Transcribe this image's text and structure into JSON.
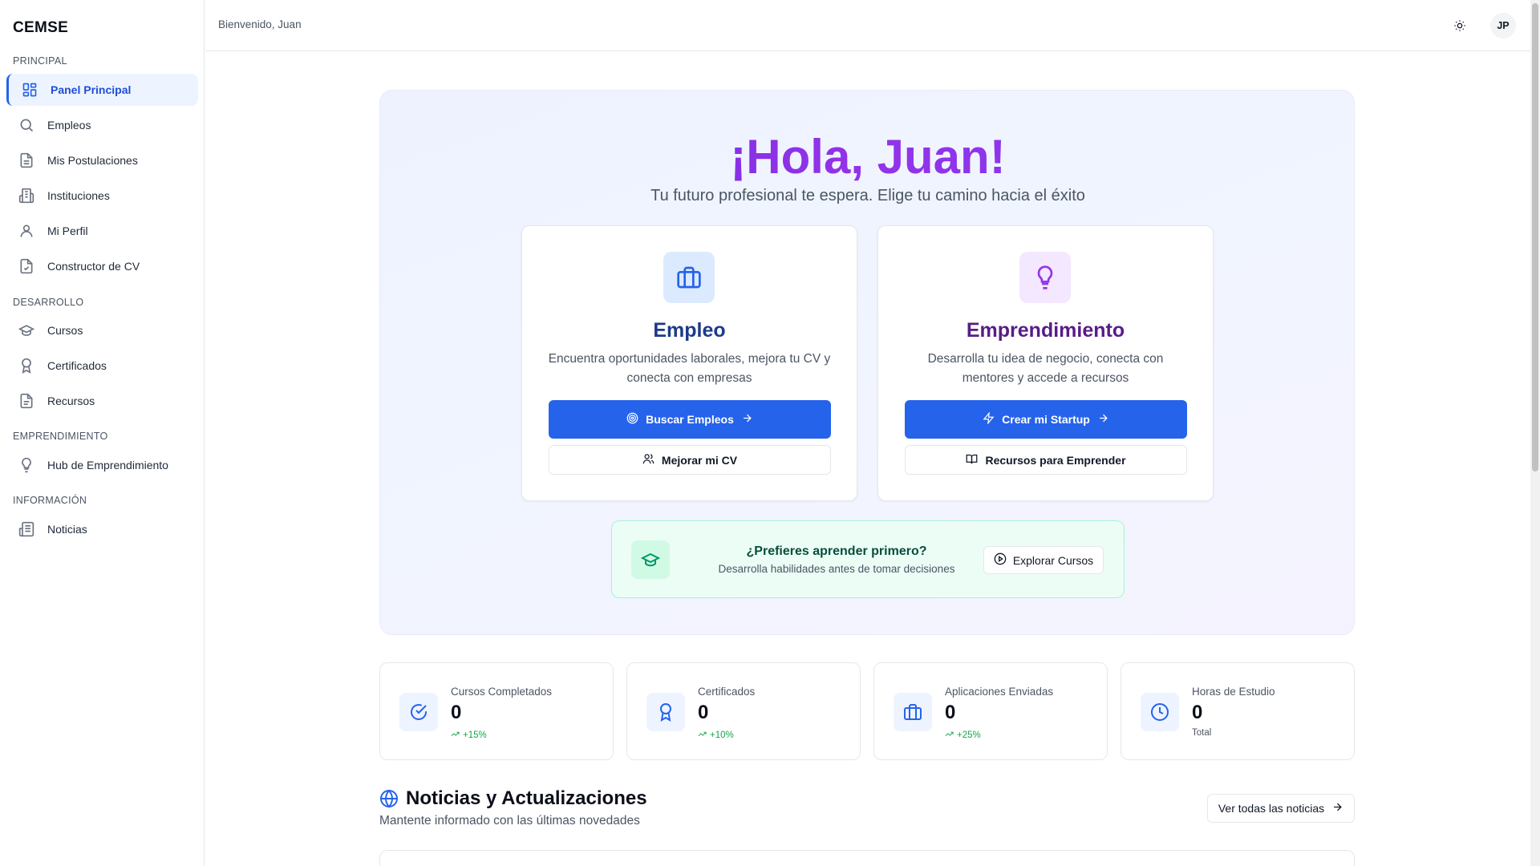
{
  "brand": "CEMSE",
  "sidebar": {
    "sections": [
      "PRINCIPAL",
      "DESARROLLO",
      "EMPRENDIMIENTO",
      "INFORMACIÓN"
    ],
    "items": [
      {
        "label": "Panel Principal",
        "icon": "dashboard-icon",
        "active": true
      },
      {
        "label": "Empleos",
        "icon": "search-icon"
      },
      {
        "label": "Mis Postulaciones",
        "icon": "document-icon"
      },
      {
        "label": "Instituciones",
        "icon": "building-icon"
      },
      {
        "label": "Mi Perfil",
        "icon": "user-icon"
      },
      {
        "label": "Constructor de CV",
        "icon": "file-check-icon"
      },
      {
        "label": "Cursos",
        "icon": "graduation-cap-icon"
      },
      {
        "label": "Certificados",
        "icon": "award-icon"
      },
      {
        "label": "Recursos",
        "icon": "file-text-icon"
      },
      {
        "label": "Hub de Emprendimiento",
        "icon": "lightbulb-icon"
      },
      {
        "label": "Noticias",
        "icon": "newspaper-icon"
      }
    ]
  },
  "topbar": {
    "welcome": "Bienvenido, Juan",
    "theme_icon": "sun-icon",
    "avatar_initials": "JP"
  },
  "hero": {
    "title": "¡Hola, Juan!",
    "subtitle": "Tu futuro profesional te espera. Elige tu camino hacia el éxito",
    "cards": [
      {
        "title": "Empleo",
        "description": "Encuentra oportunidades laborales, mejora tu CV y conecta con empresas",
        "primary_label": "Buscar Empleos",
        "secondary_label": "Mejorar mi CV",
        "icon": "briefcase-icon",
        "accent": "#1e3a8a"
      },
      {
        "title": "Emprendimiento",
        "description": "Desarrolla tu idea de negocio, conecta con mentores y accede a recursos",
        "primary_label": "Crear mi Startup",
        "secondary_label": "Recursos para Emprender",
        "icon": "lightbulb-icon",
        "accent": "#581c87"
      }
    ],
    "learn": {
      "title": "¿Prefieres aprender primero?",
      "subtitle": "Desarrolla habilidades antes de tomar decisiones",
      "button_label": "Explorar Cursos"
    }
  },
  "stats": [
    {
      "label": "Cursos Completados",
      "value": "0",
      "trend": "+15%",
      "icon": "check-circle-icon"
    },
    {
      "label": "Certificados",
      "value": "0",
      "trend": "+10%",
      "icon": "award-icon"
    },
    {
      "label": "Aplicaciones Enviadas",
      "value": "0",
      "trend": "+25%",
      "icon": "briefcase-icon"
    },
    {
      "label": "Horas de Estudio",
      "value": "0",
      "note": "Total",
      "icon": "clock-icon"
    }
  ],
  "news": {
    "title": "Noticias y Actualizaciones",
    "subtitle": "Mantente informado con las últimas novedades",
    "button_label": "Ver todas las noticias"
  },
  "colors": {
    "primary": "#2563eb",
    "hero_title": "#7c3aed",
    "empleo_title": "#1e3a8a",
    "emprendimiento_title": "#581c87",
    "trend_green": "#16a34a"
  }
}
